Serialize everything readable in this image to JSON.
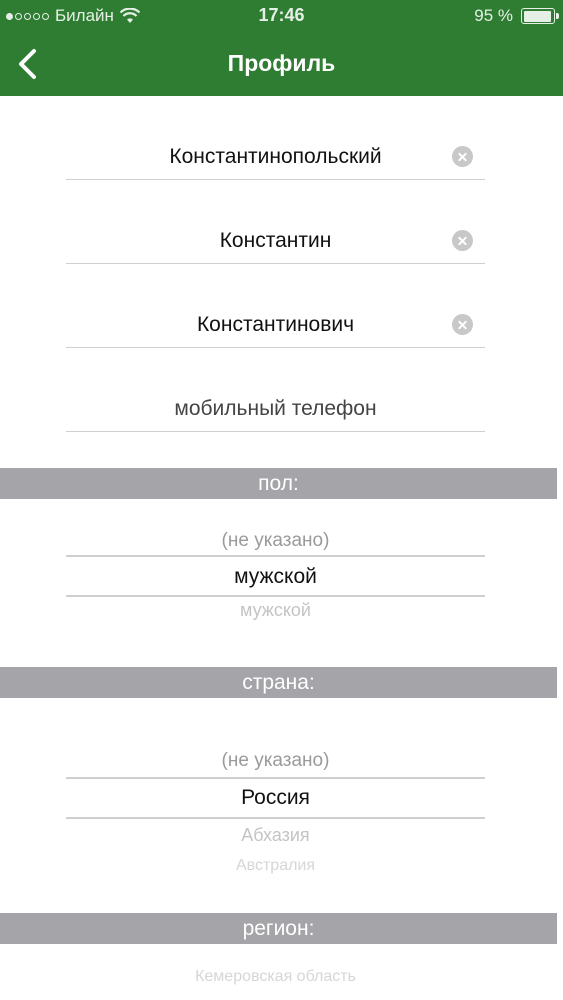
{
  "status_bar": {
    "carrier": "Билайн",
    "time": "17:46",
    "battery_text": "95 %",
    "battery_level": 0.95
  },
  "nav": {
    "title": "Профиль"
  },
  "fields": [
    {
      "value": "Константинопольский"
    },
    {
      "value": "Константин"
    },
    {
      "value": "Константинович"
    },
    {
      "placeholder": "мобильный телефон"
    }
  ],
  "gender": {
    "header": "пол:",
    "options": [
      "(не указано)",
      "мужской",
      "мужской"
    ]
  },
  "country": {
    "header": "страна:",
    "options": [
      "(не указано)",
      "Россия",
      "Абхазия",
      "Австралия"
    ]
  },
  "region": {
    "header": "регион:",
    "options": [
      "Кемеровская область"
    ]
  },
  "colors": {
    "brand_green": "#2e7d32",
    "section_gray": "#a5a5a9"
  }
}
